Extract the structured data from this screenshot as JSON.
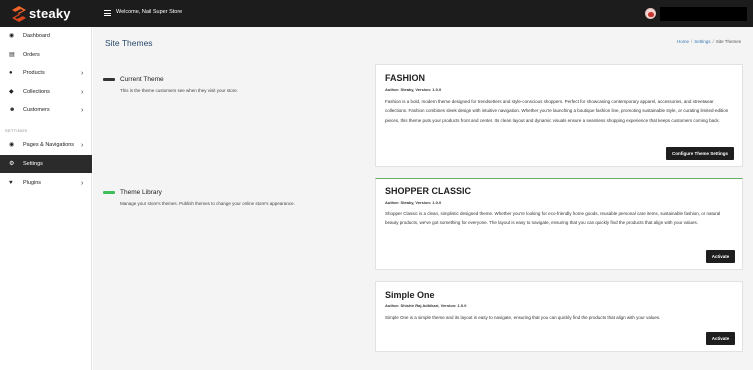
{
  "header": {
    "brand": "steaky",
    "welcome": "Welcome, Nail Super Store"
  },
  "sidebar": {
    "items": [
      {
        "label": "Dashboard",
        "icon": "dashboard-icon"
      },
      {
        "label": "Orders",
        "icon": "orders-icon"
      },
      {
        "label": "Products",
        "icon": "products-icon"
      },
      {
        "label": "Collections",
        "icon": "collections-icon"
      },
      {
        "label": "Customers",
        "icon": "customers-icon"
      },
      {
        "label": "Pages & Navigations",
        "icon": "pages-icon"
      },
      {
        "label": "Settings",
        "icon": "settings-icon"
      },
      {
        "label": "Plugins",
        "icon": "plugins-icon"
      }
    ],
    "section_label": "SETTINGS"
  },
  "page": {
    "title": "Site Themes",
    "breadcrumb": {
      "home": "Home",
      "settings": "Settings",
      "current": "Site Themes"
    }
  },
  "current_theme": {
    "title": "Current Theme",
    "description": "This is the theme customers see when they visit your store."
  },
  "theme_library": {
    "title": "Theme Library",
    "description": "Manage your store's themes. Publish themes to change your online store's appearance."
  },
  "themes": [
    {
      "name": "FASHION",
      "meta": "Author: Steaky, Version: 1.0.0",
      "description": "Fashion is a bold, modern theme designed for trendsetters and style-conscious shoppers. Perfect for showcasing contemporary apparel, accessories, and streetwear collections. Fashion combines sleek design with intuitive navigation. Whether you're launching a boutique fashion line, promoting sustainable style, or curating limited-edition pieces, this theme puts your products front and center. Its clean layout and dynamic visuals ensure a seamless shopping experience that keeps customers coming back.",
      "button": "Configure Theme Settings"
    },
    {
      "name": "SHOPPER CLASSIC",
      "meta": "Author: Steaky, Version: 1.0.0",
      "description": "Shopper Classic is a clean, simplistic designed theme. Whether you're looking for eco-friendly home goods, reusable personal care items, sustainable fashion, or natural beauty products, we've got something for everyone. The layout is easy to navigate, ensuring that you can quickly find the products that align with your values.",
      "button": "Activate"
    },
    {
      "name": "Simple One",
      "meta": "Author: Shishir Raj Adhikari, Version: 1.0.0",
      "description": "Simple One is a simple theme and its layout is easy to navigate, ensuring that you can quickly find the products that align with your values.",
      "button": "Activate"
    }
  ],
  "colors": {
    "topbar": "#1c1c1c",
    "current_theme_bar": "#333333",
    "library_bar": "#3fbf5a",
    "active_nav": "#2b2b2b",
    "title_blue": "#2a4a6a"
  }
}
